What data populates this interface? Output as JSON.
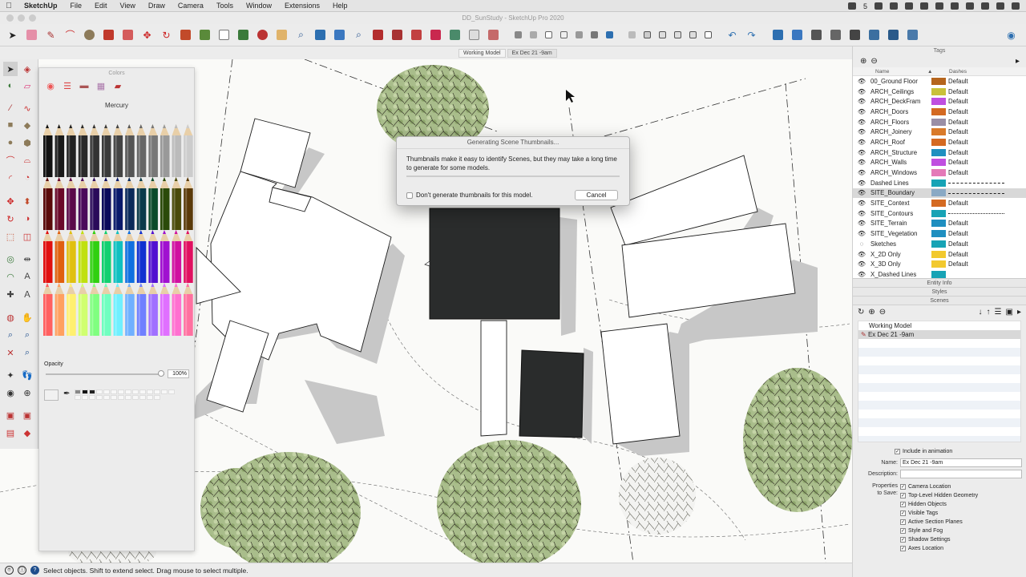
{
  "menubar": {
    "apple": "",
    "items": [
      "SketchUp",
      "File",
      "Edit",
      "View",
      "Draw",
      "Camera",
      "Tools",
      "Window",
      "Extensions",
      "Help"
    ],
    "status_number": "5"
  },
  "window": {
    "title": "DD_SunStudy - SketchUp Pro 2020"
  },
  "scene_tabs": [
    "Working Model",
    "Ex Dec 21 -9am"
  ],
  "colors_panel": {
    "title": "Colors",
    "selected_name": "Mercury",
    "opacity_label": "Opacity",
    "opacity_value": "100%",
    "opacity_fraction": 1.0
  },
  "dialog": {
    "title": "Generating Scene Thumbnails...",
    "message": "Thumbnails make it easy to identify Scenes, but they may take a long time to generate for some models.",
    "checkbox_label": "Don't generate thumbnails for this model.",
    "cancel_label": "Cancel"
  },
  "tags_panel": {
    "title": "Tags",
    "col_name": "Name",
    "col_dashes": "Dashes",
    "rows": [
      {
        "name": "00_Ground Floor",
        "color": "#b5651d",
        "dash": "Default",
        "visible": true
      },
      {
        "name": "ARCH_Ceilings",
        "color": "#c9c13a",
        "dash": "Default",
        "visible": true
      },
      {
        "name": "ARCH_DeckFram",
        "color": "#c04fe0",
        "dash": "Default",
        "visible": true
      },
      {
        "name": "ARCH_Doors",
        "color": "#d46a22",
        "dash": "Default",
        "visible": true
      },
      {
        "name": "ARCH_Floors",
        "color": "#9a8fa6",
        "dash": "Default",
        "visible": true
      },
      {
        "name": "ARCH_Joinery",
        "color": "#d97a2a",
        "dash": "Default",
        "visible": true
      },
      {
        "name": "ARCH_Roof",
        "color": "#d46a22",
        "dash": "Default",
        "visible": true
      },
      {
        "name": "ARCH_Structure",
        "color": "#1f8fc0",
        "dash": "Default",
        "visible": true
      },
      {
        "name": "ARCH_Walls",
        "color": "#c04fe0",
        "dash": "Default",
        "visible": true
      },
      {
        "name": "ARCH_Windows",
        "color": "#e47ab8",
        "dash": "Default",
        "visible": true
      },
      {
        "name": "Dashed Lines",
        "color": "#17a3b5",
        "dash": "dashed",
        "visible": true
      },
      {
        "name": "SITE_Boundary",
        "color": "#8aa9c4",
        "dash": "dash-dot",
        "visible": true,
        "selected": true
      },
      {
        "name": "SITE_Context",
        "color": "#d46a22",
        "dash": "Default",
        "visible": true
      },
      {
        "name": "SITE_Contours",
        "color": "#17a3b5",
        "dash": "dotted",
        "visible": true
      },
      {
        "name": "SITE_Terrain",
        "color": "#1f8fc0",
        "dash": "Default",
        "visible": true
      },
      {
        "name": "SITE_Vegetation",
        "color": "#1f8fc0",
        "dash": "Default",
        "visible": true
      },
      {
        "name": "Sketches",
        "color": "#17a3b5",
        "dash": "Default",
        "visible": false
      },
      {
        "name": "X_2D Only",
        "color": "#f2c92e",
        "dash": "Default",
        "visible": true
      },
      {
        "name": "X_3D Only",
        "color": "#f2c92e",
        "dash": "Default",
        "visible": true
      },
      {
        "name": "X_Dashed Lines",
        "color": "#17a3b5",
        "dash": "",
        "visible": true
      }
    ]
  },
  "tray_sections": {
    "entity_info": "Entity Info",
    "styles": "Styles",
    "scenes": "Scenes"
  },
  "scenes_panel": {
    "list": [
      {
        "name": "Working Model",
        "selected": false
      },
      {
        "name": "Ex Dec 21 -9am",
        "selected": true
      }
    ],
    "include_in_animation": "Include in animation",
    "name_label": "Name:",
    "name_value": "Ex Dec 21 -9am",
    "description_label": "Description:",
    "properties_label_1": "Properties",
    "properties_label_2": "to Save:",
    "properties": [
      "Camera Location",
      "Top-Level Hidden Geometry",
      "Hidden Objects",
      "Visible Tags",
      "Active Section Planes",
      "Style and Fog",
      "Shadow Settings",
      "Axes Location"
    ]
  },
  "statusbar": {
    "message": "Select objects. Shift to extend select. Drag mouse to select multiple."
  },
  "colors": {
    "accent_blue": "#1f4e8c",
    "building_dark": "#2a2c2c",
    "shadow": "#c8c8c8",
    "tree_green": "#9bb37c"
  }
}
